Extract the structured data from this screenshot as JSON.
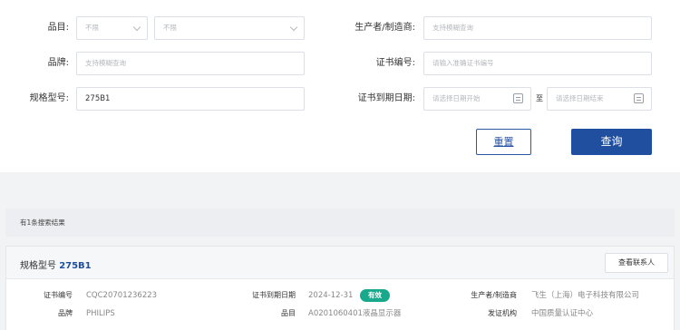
{
  "form": {
    "category_label": "品目:",
    "category_select1": "不限",
    "category_select2": "不限",
    "brand_label": "品牌:",
    "brand_placeholder": "支持模糊查询",
    "model_label": "规格型号:",
    "model_value": "275B1",
    "manufacturer_label": "生产者/制造商:",
    "manufacturer_placeholder": "支持模糊查询",
    "cert_no_label": "证书编号:",
    "cert_no_placeholder": "请输入准确证书编号",
    "expiry_label": "证书到期日期:",
    "expiry_start_placeholder": "请选择日期开始",
    "range_sep": "至",
    "expiry_end_placeholder": "请选择日期结束",
    "reset_label": "重置",
    "query_label": "查询"
  },
  "results": {
    "count_text": "有1条搜索结果",
    "card": {
      "title_prefix": "规格型号",
      "title_model": "275B1",
      "contact_label": "查看联系人",
      "cert_no_key": "证书编号",
      "cert_no_value": "CQC20701236223",
      "expiry_key": "证书到期日期",
      "expiry_value": "2024-12-31",
      "status_badge": "有效",
      "manufacturer_key": "生产者/制造商",
      "manufacturer_value": "飞生（上海）电子科技有限公司",
      "brand_key": "品牌",
      "brand_value": "PHILIPS",
      "category_key": "品目",
      "category_value": "A0201060401液晶显示器",
      "issuer_key": "发证机构",
      "issuer_value": "中国质量认证中心"
    }
  },
  "colors": {
    "primary": "#1f4f9e",
    "valid_badge": "#18a98c",
    "page_bg": "#f2f3f5"
  },
  "icons": [
    "chevron-down-icon",
    "calendar-icon"
  ]
}
